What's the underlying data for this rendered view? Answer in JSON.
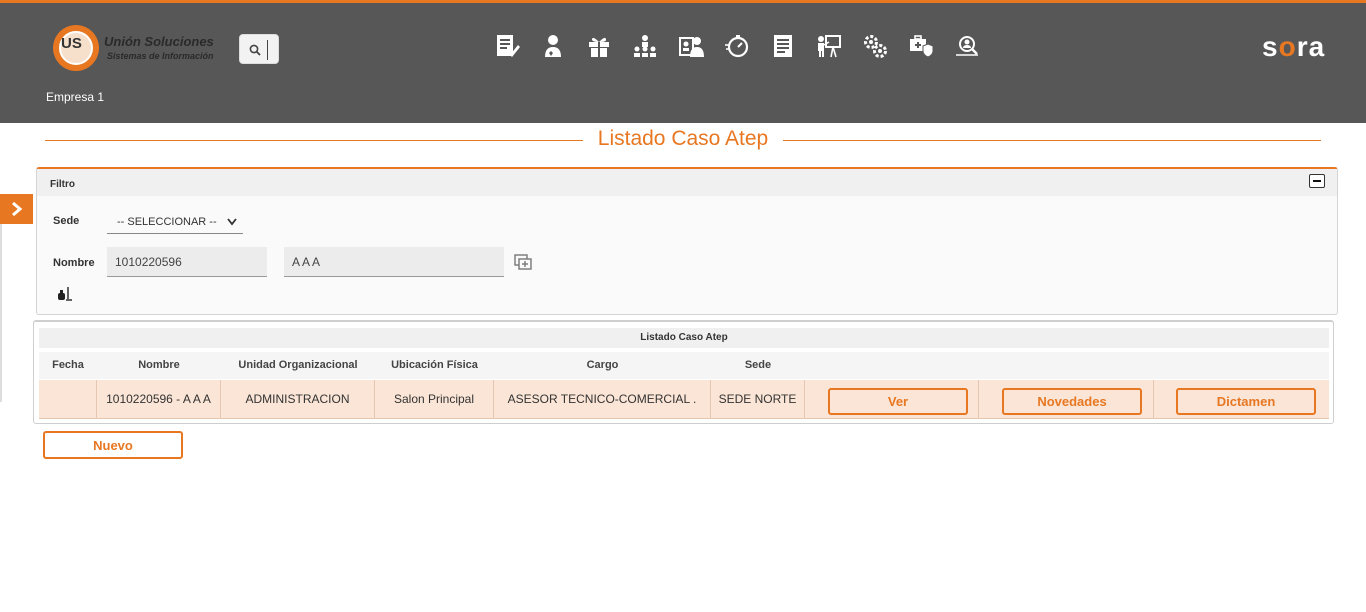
{
  "header": {
    "logo_text_main": "Unión Soluciones",
    "logo_text_sub": "Sistemas de Información",
    "logo_badge": "US",
    "brand_pre": "s",
    "brand_o": "o",
    "brand_post": "ra",
    "company": "Empresa 1",
    "toolbar_icons": [
      "document-edit-icon",
      "user-heart-icon",
      "gift-icon",
      "team-hierarchy-icon",
      "id-card-user-icon",
      "stopwatch-icon",
      "report-list-icon",
      "presentation-icon",
      "gears-icon",
      "medical-shield-icon",
      "user-search-icon"
    ]
  },
  "title": "Listado Caso Atep",
  "filter": {
    "panel_title": "Filtro",
    "sede_label": "Sede",
    "sede_value": "-- SELECCIONAR --",
    "nombre_label": "Nombre",
    "nombre_id": "1010220596",
    "nombre_name": "A A A"
  },
  "table": {
    "caption": "Listado Caso Atep",
    "headers": [
      "Fecha",
      "Nombre",
      "Unidad Organizacional",
      "Ubicación Física",
      "Cargo",
      "Sede"
    ],
    "rows": [
      {
        "fecha": "",
        "nombre": "1010220596 - A A A",
        "unidad": "ADMINISTRACION",
        "ubicacion": "Salon Principal",
        "cargo": "ASESOR TECNICO-COMERCIAL .",
        "sede": "SEDE NORTE",
        "btn_ver": "Ver",
        "btn_novedades": "Novedades",
        "btn_dictamen": "Dictamen"
      }
    ]
  },
  "actions": {
    "nuevo": "Nuevo"
  },
  "colors": {
    "accent": "#e87722",
    "header_bg": "#575757",
    "row_bg": "#fae5d6"
  }
}
